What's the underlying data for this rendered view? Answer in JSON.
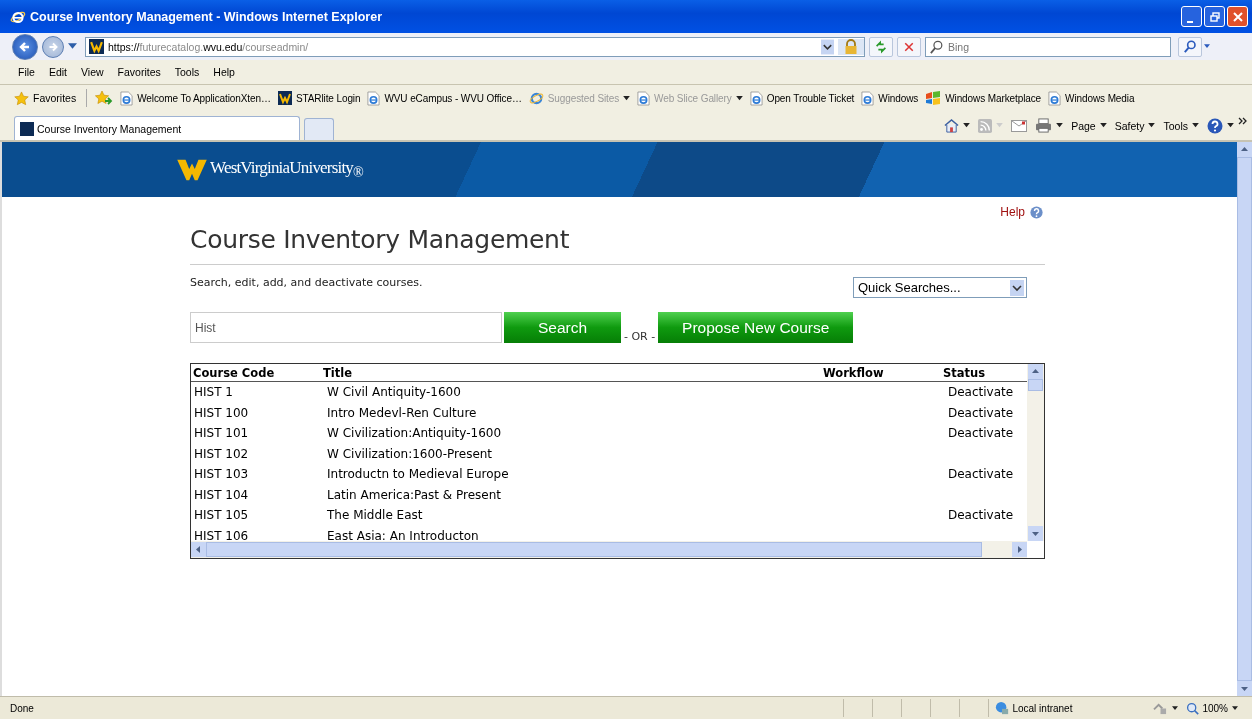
{
  "window": {
    "title": "Course Inventory Management - Windows Internet Explorer"
  },
  "address": {
    "scheme": "https://",
    "host_prefix": "futurecatalog.",
    "domain": "wvu.edu",
    "path": "/courseadmin/"
  },
  "search_box": {
    "placeholder": "Bing"
  },
  "menu": [
    "File",
    "Edit",
    "View",
    "Favorites",
    "Tools",
    "Help"
  ],
  "favorites_bar": {
    "label": "Favorites",
    "items": [
      {
        "label": "Welcome To ApplicationXten…",
        "kind": "ie",
        "disabled": false,
        "dropdown": false
      },
      {
        "label": "STARlite Login",
        "kind": "wvu",
        "disabled": false,
        "dropdown": false
      },
      {
        "label": "WVU eCampus - WVU Office…",
        "kind": "ie",
        "disabled": false,
        "dropdown": false
      },
      {
        "label": "Suggested Sites",
        "kind": "suggested",
        "disabled": true,
        "dropdown": true
      },
      {
        "label": "Web Slice Gallery",
        "kind": "ie",
        "disabled": true,
        "dropdown": true
      },
      {
        "label": "Open Trouble Ticket",
        "kind": "ie",
        "disabled": false,
        "dropdown": false
      },
      {
        "label": "Windows",
        "kind": "ie",
        "disabled": false,
        "dropdown": false
      },
      {
        "label": "Windows Marketplace",
        "kind": "marketplace",
        "disabled": false,
        "dropdown": false
      },
      {
        "label": "Windows Media",
        "kind": "ie",
        "disabled": false,
        "dropdown": false
      }
    ]
  },
  "tabs": [
    {
      "label": "Course Inventory Management",
      "selected": true
    }
  ],
  "command_bar": [
    "Page",
    "Safety",
    "Tools"
  ],
  "page": {
    "logo": "WestVirginiaUniversity$_{®}$",
    "help": "Help",
    "heading": "Course Inventory Management",
    "intro": "Search, edit, add, and deactivate courses.",
    "quick_searches": "Quick Searches...",
    "search_value": "Hist",
    "search_button": "Search",
    "or": "- OR -",
    "propose_button": "Propose New Course",
    "table": {
      "columns": [
        "Course Code",
        "Title",
        "Workflow",
        "Status"
      ],
      "rows": [
        {
          "code": "HIST 1",
          "title": "W Civil Antiquity-1600",
          "workflow": "",
          "status": "Deactivate"
        },
        {
          "code": "HIST 100",
          "title": "Intro Medevl-Ren Culture",
          "workflow": "",
          "status": "Deactivate"
        },
        {
          "code": "HIST 101",
          "title": "W Civilization:Antiquity-1600",
          "workflow": "",
          "status": "Deactivate"
        },
        {
          "code": "HIST 102",
          "title": "W Civilization:1600-Present",
          "workflow": "",
          "status": ""
        },
        {
          "code": "HIST 103",
          "title": "Introductn to Medieval Europe",
          "workflow": "",
          "status": "Deactivate"
        },
        {
          "code": "HIST 104",
          "title": "Latin America:Past & Present",
          "workflow": "",
          "status": ""
        },
        {
          "code": "HIST 105",
          "title": "The Middle East",
          "workflow": "",
          "status": "Deactivate"
        },
        {
          "code": "HIST 106",
          "title": "East Asia: An Introducton",
          "workflow": "",
          "status": ""
        }
      ]
    }
  },
  "status_bar": {
    "text": "Done",
    "zone": "Local intranet",
    "zoom": "100%"
  }
}
